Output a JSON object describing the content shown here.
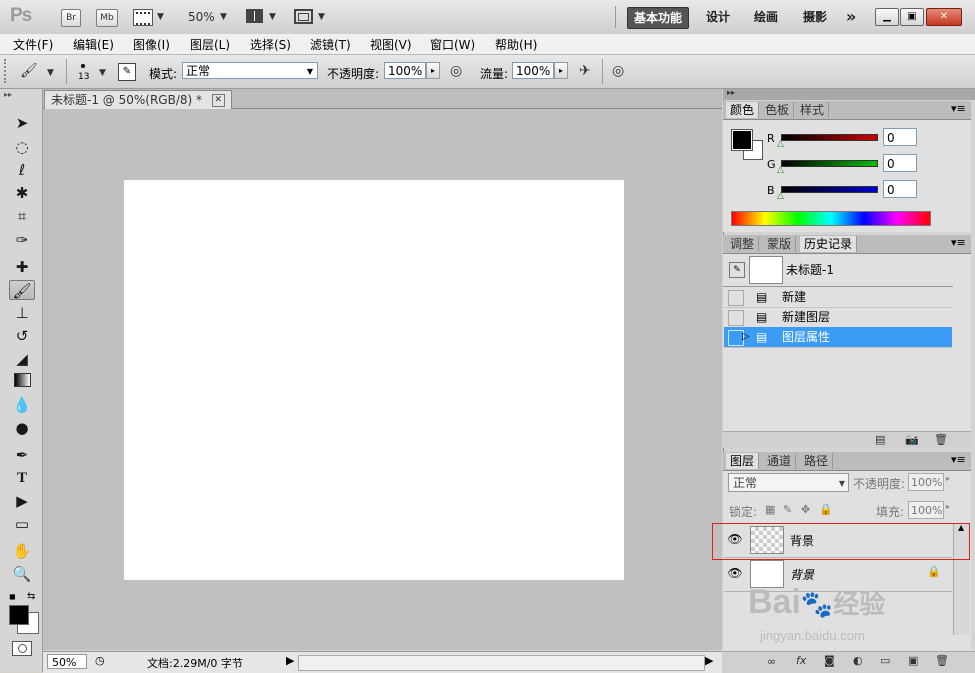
{
  "appbar": {
    "logo": "Ps",
    "bridge_btn": "Br",
    "minibridge_btn": "Mb",
    "zoom": "50%",
    "workspaces": [
      "基本功能",
      "设计",
      "绘画",
      "摄影"
    ],
    "more": "»"
  },
  "menus": [
    "文件(F)",
    "编辑(E)",
    "图像(I)",
    "图层(L)",
    "选择(S)",
    "滤镜(T)",
    "视图(V)",
    "窗口(W)",
    "帮助(H)"
  ],
  "options": {
    "brush_size": "13",
    "mode_label": "模式:",
    "mode_value": "正常",
    "opacity_label": "不透明度:",
    "opacity_value": "100%",
    "flow_label": "流量:",
    "flow_value": "100%"
  },
  "document": {
    "tab_title": "未标题-1 @ 50%(RGB/8) *",
    "status_zoom": "50%",
    "status_info": "文档:2.29M/0 字节"
  },
  "color_panel": {
    "tabs": [
      "颜色",
      "色板",
      "样式"
    ],
    "r_label": "R",
    "r_value": "0",
    "g_label": "G",
    "g_value": "0",
    "b_label": "B",
    "b_value": "0",
    "fg": "#000000",
    "bg": "#ffffff"
  },
  "history_panel": {
    "tabs": [
      "调整",
      "蒙版",
      "历史记录"
    ],
    "snapshot": "未标题-1",
    "items": [
      "新建",
      "新建图层",
      "图层属性"
    ],
    "selected_color": "#3b9cf5"
  },
  "layers_panel": {
    "tabs": [
      "图层",
      "通道",
      "路径"
    ],
    "blend_mode": "正常",
    "opacity_label": "不透明度:",
    "opacity_value": "100%",
    "lock_label": "锁定:",
    "fill_label": "填充:",
    "fill_value": "100%",
    "layers": [
      {
        "name": "背景",
        "thumb": "transparent"
      },
      {
        "name": "背景",
        "thumb": "white",
        "locked": true
      }
    ]
  },
  "watermark": {
    "text": "Bai",
    "cn": "经验",
    "url": "jingyan.baidu.com"
  }
}
